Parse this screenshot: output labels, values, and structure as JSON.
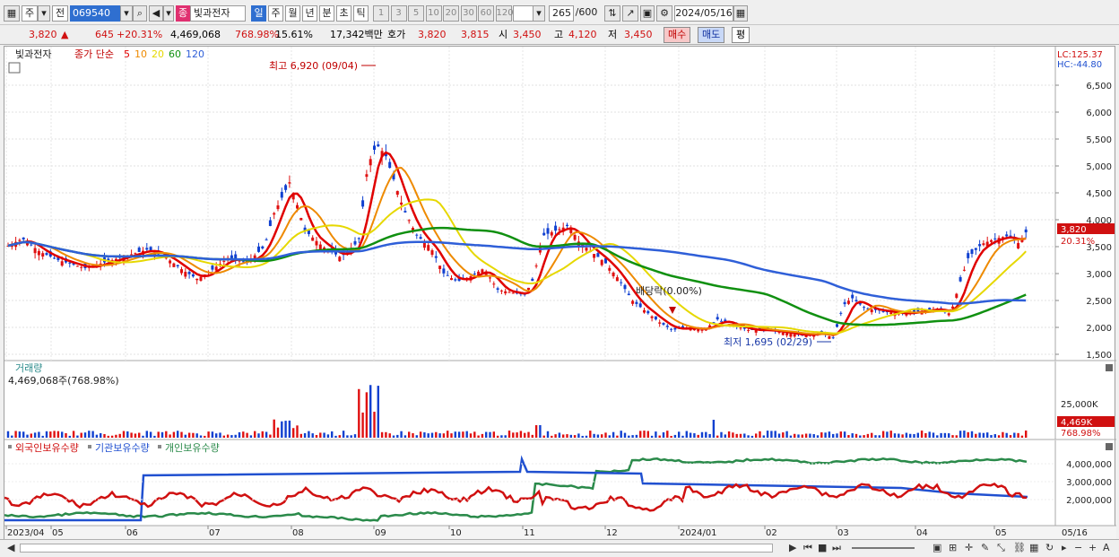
{
  "toolbar": {
    "market": "주",
    "prefix": "전",
    "code": "069540",
    "badge": "종",
    "name": "빛과전자",
    "periods": [
      "일",
      "주",
      "월",
      "년",
      "분",
      "초",
      "틱"
    ],
    "active_period": "일",
    "intervals": [
      "1",
      "3",
      "5",
      "10",
      "20",
      "30",
      "60",
      "120"
    ],
    "count": "265",
    "count_max": "/600",
    "date": "2024/05/16"
  },
  "quote": {
    "price": "3,820",
    "arrow": "▲",
    "change": "645",
    "change_pct": "+20.31%",
    "volume": "4,469,068",
    "volume_pct": "768.98%",
    "turnover": "15.61%",
    "amount": "17,342백만",
    "ask_label": "호가",
    "ask": "3,820",
    "bid": "3,815",
    "open_label": "시",
    "open": "3,450",
    "high_label": "고",
    "high": "4,120",
    "low_label": "저",
    "low": "3,450",
    "buy": "매수",
    "sell": "매도",
    "eval": "평"
  },
  "price_panel": {
    "name": "빛과전자",
    "legend": [
      {
        "label": "종가 단순",
        "color": "#c00000"
      },
      {
        "label": "5",
        "color": "#e00000"
      },
      {
        "label": "10",
        "color": "#ee8a00"
      },
      {
        "label": "20",
        "color": "#e6d800"
      },
      {
        "label": "60",
        "color": "#109010"
      },
      {
        "label": "120",
        "color": "#2f5fd8"
      }
    ],
    "lc": "LC:125.37",
    "hc": "HC:-44.80",
    "yticks": [
      "6,500",
      "6,000",
      "5,500",
      "5,000",
      "4,500",
      "4,000",
      "3,500",
      "3,000",
      "2,500",
      "2,000",
      "1,500"
    ],
    "last_price": "3,820",
    "last_pct": "20.31%",
    "high_note": "최고 6,920 (09/04)",
    "low_note": "최저 1,695 (02/29)",
    "div_note": "배당락(0.00%)"
  },
  "volume_panel": {
    "title": "거래량",
    "value": "4,469,068주(768.98%)",
    "ytick": "25,000K",
    "last": "4,469K",
    "last_pct": "768.98%"
  },
  "holdings_panel": {
    "legend": [
      {
        "label": "외국인보유수량",
        "color": "#d01010"
      },
      {
        "label": "기관보유수량",
        "color": "#2050d0"
      },
      {
        "label": "개인보유수량",
        "color": "#2a8a4a"
      }
    ],
    "yticks": [
      "4,000,000",
      "3,000,000",
      "2,000,000"
    ]
  },
  "xaxis": [
    "2023/04",
    "05",
    "06",
    "07",
    "08",
    "09",
    "10",
    "11",
    "12",
    "2024/01",
    "02",
    "03",
    "04",
    "05",
    "05/16"
  ],
  "chart_data": {
    "type": "candlestick",
    "x": [
      "2023/04",
      "05",
      "06",
      "07",
      "08",
      "09",
      "10",
      "11",
      "12",
      "2024/01",
      "02",
      "03",
      "04",
      "05",
      "05/16"
    ],
    "close_approx": [
      3500,
      3100,
      3300,
      3200,
      3600,
      5000,
      3000,
      2800,
      3500,
      2200,
      1900,
      2400,
      2300,
      3600,
      3820
    ],
    "y_range": [
      1500,
      7000
    ],
    "high": {
      "value": 6920,
      "date": "09/04"
    },
    "low": {
      "value": 1695,
      "date": "02/29"
    },
    "last": 3820,
    "moving_averages": [
      5,
      10,
      20,
      60,
      120
    ]
  }
}
